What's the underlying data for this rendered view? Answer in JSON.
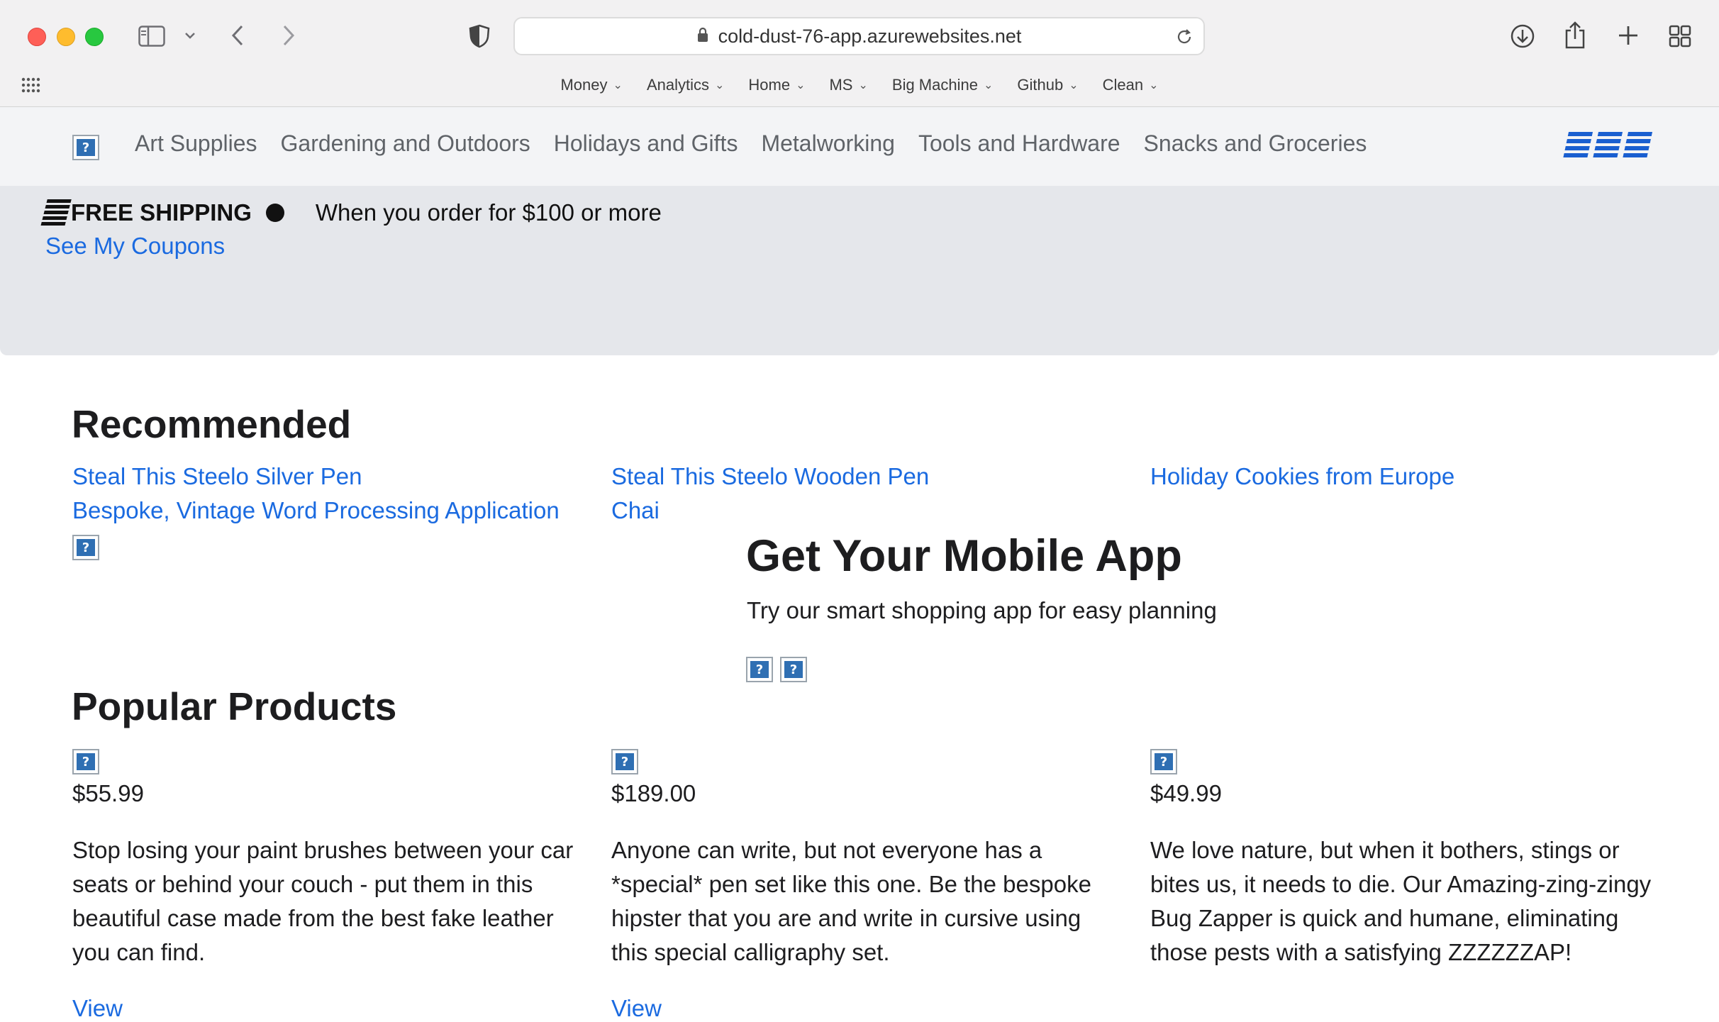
{
  "browser": {
    "url": "cold-dust-76-app.azurewebsites.net",
    "bookmarks": [
      "Money",
      "Analytics",
      "Home",
      "MS",
      "Big Machine",
      "Github",
      "Clean"
    ]
  },
  "nav": {
    "links": [
      "Art Supplies",
      "Gardening and Outdoors",
      "Holidays and Gifts",
      "Metalworking",
      "Tools and Hardware",
      "Snacks and Groceries"
    ]
  },
  "banner": {
    "title": "FREE SHIPPING",
    "subtitle": "When you order for $100 or more",
    "coupons_link": "See My Coupons"
  },
  "recommended": {
    "heading": "Recommended",
    "items": [
      "Steal This Steelo Silver Pen",
      "Steal This Steelo Wooden Pen",
      "Holiday Cookies from Europe",
      "Bespoke, Vintage Word Processing Application",
      "Chai"
    ]
  },
  "mobile_app": {
    "title": "Get Your Mobile App",
    "subtitle": "Try our smart shopping app for easy planning"
  },
  "popular": {
    "heading": "Popular Products",
    "products": [
      {
        "price": "$55.99",
        "description": "Stop losing your paint brushes between your car seats or behind your couch - put them in this beautiful case made from the best fake leather you can find.",
        "view_label": "View"
      },
      {
        "price": "$189.00",
        "description": "Anyone can write, but not everyone has a *special* pen set like this one. Be the bespoke hipster that you are and write in cursive using this special calligraphy set.",
        "view_label": "View"
      },
      {
        "price": "$49.99",
        "description": "We love nature, but when it bothers, stings or bites us, it needs to die. Our Amazing-zing-zingy Bug Zapper is quick and humane, eliminating those pests with a satisfying ZZZZZZAP!",
        "view_label": ""
      }
    ]
  },
  "colors": {
    "link": "#1a6ae0",
    "banner_bg": "#e5e7eb",
    "nav_bg": "#f3f4f6"
  }
}
